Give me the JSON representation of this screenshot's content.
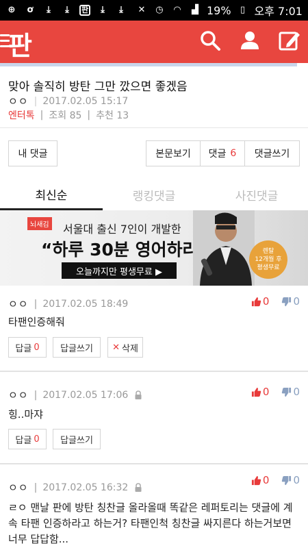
{
  "status_bar": {
    "battery": "19%",
    "time": "오후 7:01"
  },
  "app": {
    "logo": "판"
  },
  "post": {
    "title": "맞아 솔직히 방탄 그만 깠으면 좋겠음",
    "author": "ㅇㅇ",
    "date": "2017.02.05 15:17",
    "category": "엔터톡",
    "views": "조회 85",
    "recommends": "추천 13"
  },
  "actions": {
    "my_comments": "내 댓글",
    "view_post": "본문보기",
    "comments_label": "댓글",
    "comments_count": "6",
    "write_comment": "댓글쓰기"
  },
  "tabs": [
    {
      "label": "최신순",
      "active": true
    },
    {
      "label": "랭킹댓글",
      "active": false
    },
    {
      "label": "사진댓글",
      "active": false
    }
  ],
  "ad": {
    "tag": "뇌새김",
    "subtitle": "서울대 출신 7인이 개발한",
    "headline": "“하루 30분 영어하라”",
    "cta": "오늘까지만 평생무료 ▶",
    "badge_line1": "렌탈",
    "badge_line2": "12개월 후",
    "badge_line3": "평생무료"
  },
  "comments": [
    {
      "author": "ㅇㅇ",
      "date": "2017.02.05 18:49",
      "up": "0",
      "down": "0",
      "body": "타팬인증해줘",
      "reply_label": "답글",
      "reply_count": "0",
      "write_reply": "답글쓰기",
      "delete": "삭제"
    },
    {
      "author": "ㅇㅇ",
      "date": "2017.02.05 17:06",
      "up": "0",
      "down": "0",
      "body": "힝..마쟈",
      "reply_label": "답글",
      "reply_count": "0",
      "write_reply": "답글쓰기"
    },
    {
      "author": "ㅇㅇ",
      "date": "2017.02.05 16:32",
      "up": "0",
      "down": "0",
      "body": "ㄹㅇ 맨날 판에 방탄 칭찬글 올라올때 똑같은 레퍼토리는 댓글에 계속 타팬 인증하라고 하는거? 타팬인척 칭찬글 싸지른다 하는거보면 너무 답답함..."
    }
  ],
  "colors": {
    "brand": "#e8463f",
    "accent_red": "#e83a3a",
    "down_blue": "#8aa0c0"
  },
  "icons": {
    "menu": "menu-icon",
    "search": "search-icon",
    "profile": "user-icon",
    "write": "edit-icon",
    "lock": "lock-icon",
    "upvote": "thumbs-up-icon",
    "downvote": "thumbs-down-icon"
  }
}
